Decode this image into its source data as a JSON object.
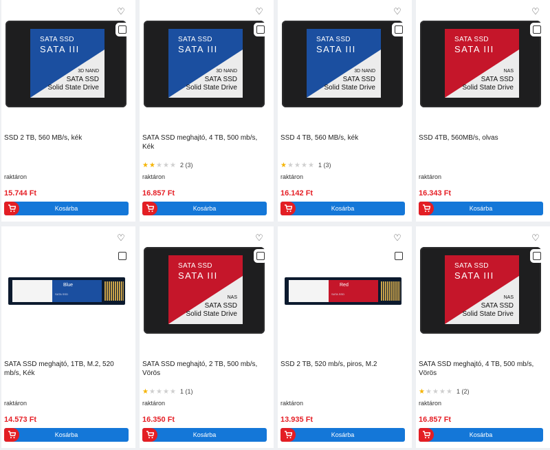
{
  "cart_label": "Kosárba",
  "colors": {
    "price": "#e51e25",
    "cart_button": "#1477d8",
    "cart_icon_bg": "#e31e24",
    "star": "#f5b400",
    "blue_label": "#1b4fa0",
    "red_label": "#c5162a"
  },
  "products": [
    {
      "title": "SSD 2 TB, 560 MB/s, kék",
      "rating_text": "",
      "stars": 0,
      "stock": "raktáron",
      "price": "15.744 Ft",
      "image": {
        "l1": "SATA SSD",
        "l2": "SATA III",
        "l3": "3D NAND",
        "l4": "SATA SSD",
        "l5": "Solid State Drive",
        "color": "#1b4fa0"
      }
    },
    {
      "title": "SATA SSD meghajtó, 4 TB, 500 mb/s, Kék",
      "rating_text": "2 (3)",
      "stars": 2,
      "stock": "raktáron",
      "price": "16.857 Ft",
      "image": {
        "l1": "SATA SSD",
        "l2": "SATA III",
        "l3": "3D NAND",
        "l4": "SATA SSD",
        "l5": "Solid State Drive",
        "color": "#1b4fa0"
      }
    },
    {
      "title": "SSD 4 TB, 560 MB/s, kék",
      "rating_text": "1 (3)",
      "stars": 1,
      "stock": "raktáron",
      "price": "16.142 Ft",
      "image": {
        "l1": "SATA SSD",
        "l2": "SATA III",
        "l3": "3D NAND",
        "l4": "SATA SSD",
        "l5": "Solid State Drive",
        "color": "#1b4fa0"
      }
    },
    {
      "title": "SSD 4TB, 560MB/s, olvas",
      "rating_text": "",
      "stars": 0,
      "stock": "raktáron",
      "price": "16.343 Ft",
      "image": {
        "l1": "SATA SSD",
        "l2": "SATA III",
        "l3": "NAS",
        "l4": "SATA SSD",
        "l5": "Solid State Drive",
        "color": "#c5162a"
      }
    },
    {
      "title": "SATA SSD meghajtó, 1TB, M.2, 520 mb/s, Kék",
      "rating_text": "",
      "stars": 0,
      "stock": "raktáron",
      "price": "14.573 Ft",
      "image": {
        "brand": "Blue",
        "small": "SATA SSD",
        "color": "#1b4fa0"
      }
    },
    {
      "title": "SATA SSD meghajtó, 2 TB, 500 mb/s, Vörös",
      "rating_text": "1 (1)",
      "stars": 1,
      "stock": "raktáron",
      "price": "16.350 Ft",
      "image": {
        "l1": "SATA SSD",
        "l2": "SATA III",
        "l3": "NAS",
        "l4": "SATA SSD",
        "l5": "Solid State Drive",
        "color": "#c5162a"
      }
    },
    {
      "title": "SSD 2 TB, 520 mb/s, piros, M.2",
      "rating_text": "",
      "stars": 0,
      "stock": "raktáron",
      "price": "13.935 Ft",
      "image": {
        "brand": "Red",
        "small": "SATA SSD",
        "color": "#c5162a"
      }
    },
    {
      "title": "SATA SSD meghajtó, 4 TB, 500 mb/s, Vörös",
      "rating_text": "1 (2)",
      "stars": 1,
      "stock": "raktáron",
      "price": "16.857 Ft",
      "image": {
        "l1": "SATA SSD",
        "l2": "SATA III",
        "l3": "NAS",
        "l4": "SATA SSD",
        "l5": "Solid State Drive",
        "color": "#c5162a"
      }
    }
  ]
}
